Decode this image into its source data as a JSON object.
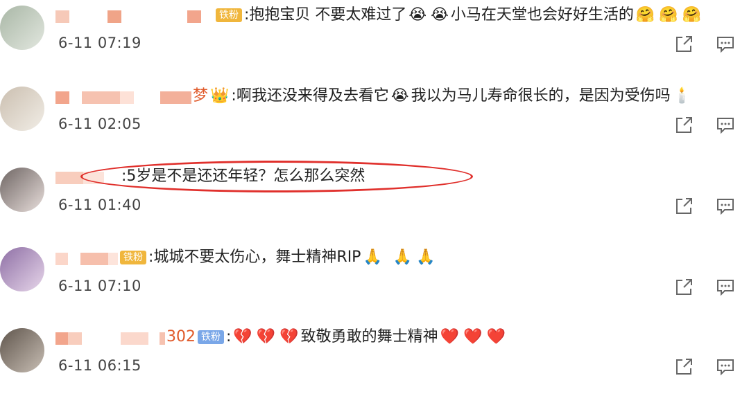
{
  "comments": [
    {
      "badge": "铁粉",
      "text_before": ":抱抱宝贝 不要太难过了",
      "text_mid": "小马在天堂也会好好生活的",
      "time": "6-11 07:19",
      "avatar_color": "#c7d6c4"
    },
    {
      "name_suffix": "梦",
      "text": ":啊我还没来得及去看它",
      "text2": "我以为马儿寿命很长的，是因为受伤吗",
      "time": "6-11 02:05",
      "avatar_color": "#d9d3c8"
    },
    {
      "text": ":5岁是不是还还年轻？怎么那么突然",
      "time": "6-11 01:40",
      "avatar_color": "#bdb4b0"
    },
    {
      "badge": "铁粉",
      "text": ":城城不要太伤心，舞士精神RIP",
      "time": "6-11 07:10",
      "avatar_color": "#b79cc8"
    },
    {
      "name_suffix": "302",
      "badge": "铁粉",
      "text": "致敬勇敢的舞士精神",
      "time": "6-11 06:15",
      "avatar_color": "#9a8f84"
    }
  ],
  "icons": {
    "share": "share-icon",
    "reply": "comment-icon"
  },
  "colors": {
    "highlight_oval": "#e0302c",
    "badge_gold": "#f0b63c",
    "badge_blue": "#7aa7e8"
  }
}
